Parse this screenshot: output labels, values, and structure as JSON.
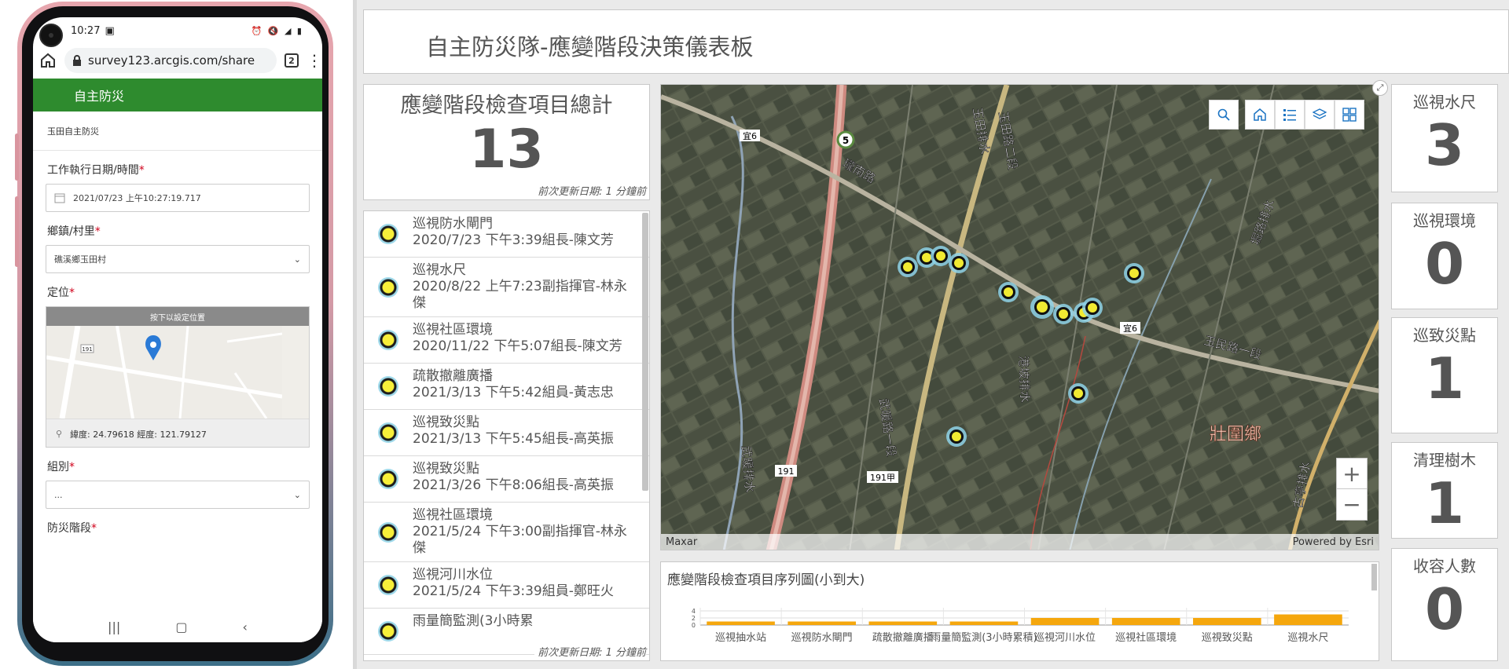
{
  "phone": {
    "status_time": "10:27",
    "status_icons": "⏰ 🔇 ◢ ▮",
    "url": "survey123.arcgis.com/share",
    "tab_count": "2",
    "form_header": "自主防災",
    "form_sub": "玉田自主防災",
    "fields": [
      {
        "label": "工作執行日期/時間",
        "value": "2021/07/23 上午10:27:19.717"
      },
      {
        "label": "鄉鎮/村里",
        "value": "礁溪鄉玉田村"
      },
      {
        "label": "定位"
      },
      {
        "label": "組別",
        "value": "..."
      },
      {
        "label": "防災階段"
      }
    ],
    "map_hint": "按下以設定位置",
    "road_number": "191",
    "coords": "緯度: 24.79618  經度: 121.79127"
  },
  "dashboard": {
    "title": "自主防災隊-應變階段決策儀表板",
    "total": {
      "label": "應變階段檢查項目總計",
      "value": "13",
      "footer": "前次更新日期: 1 分鐘前"
    },
    "list": {
      "items": [
        {
          "title": "巡視防水閘門",
          "detail": "2020/7/23 下午3:39組長-陳文芳"
        },
        {
          "title": "巡視水尺",
          "detail": "2020/8/22 上午7:23副指揮官-林永傑"
        },
        {
          "title": "巡視社區環境",
          "detail": "2020/11/22 下午5:07組長-陳文芳"
        },
        {
          "title": "疏散撤離廣播",
          "detail": "2021/3/13 下午5:42組員-黃志忠"
        },
        {
          "title": "巡視致災點",
          "detail": "2021/3/13 下午5:45組長-高英振"
        },
        {
          "title": "巡視致災點",
          "detail": "2021/3/26 下午8:06組長-高英振"
        },
        {
          "title": "巡視社區環境",
          "detail": "2021/5/24 下午3:00副指揮官-林永傑"
        },
        {
          "title": "巡視河川水位",
          "detail": "2021/5/24 下午3:39組員-鄭旺火"
        },
        {
          "title": "雨量簡監測(3小時累",
          "detail": ""
        }
      ],
      "footer": "前次更新日期: 1 分鐘前"
    },
    "map": {
      "labels": {
        "road1": "宜6",
        "road2": "宜6",
        "hw5": "5",
        "r191": "191",
        "r191a": "191甲",
        "place": "壯圍鄉",
        "ch1": "玉田排水",
        "ch2": "玉田路二段",
        "ch3": "玉民路一段",
        "ch4": "港坡排水",
        "ch5": "堀路排水",
        "ch6": "古亭排水",
        "ch7": "武暖排水",
        "ch8": "武暖路一段",
        "ch9": "瓏南路"
      },
      "attribution_left": "Maxar",
      "attribution_right": "Powered by Esri"
    },
    "chart_title": "應變階段檢查項目序列圖(小到大)",
    "stats": [
      {
        "label": "巡視水尺",
        "value": "3"
      },
      {
        "label": "巡視環境",
        "value": "0"
      },
      {
        "label": "巡致災點",
        "value": "1"
      },
      {
        "label": "清理樹木",
        "value": "1"
      },
      {
        "label": "收容人數",
        "value": "0"
      }
    ]
  },
  "chart_data": {
    "type": "bar",
    "title": "應變階段檢查項目序列圖(小到大)",
    "categories": [
      "巡視抽水站",
      "巡視防水閘門",
      "疏散撤離廣播",
      "雨量簡監測(3小時累積)",
      "巡視河川水位",
      "巡視社區環境",
      "巡視致災點",
      "巡視水尺"
    ],
    "values": [
      1,
      1,
      1,
      1,
      2,
      2,
      2,
      3
    ],
    "ylim": [
      0,
      4
    ],
    "yticks": [
      "4",
      "2",
      "0"
    ],
    "color": "#f5a70d",
    "grid": true
  },
  "colors": {
    "form_green": "#2e8b2e",
    "accent_blue": "#1c74c3",
    "bar": "#f5a70d"
  }
}
